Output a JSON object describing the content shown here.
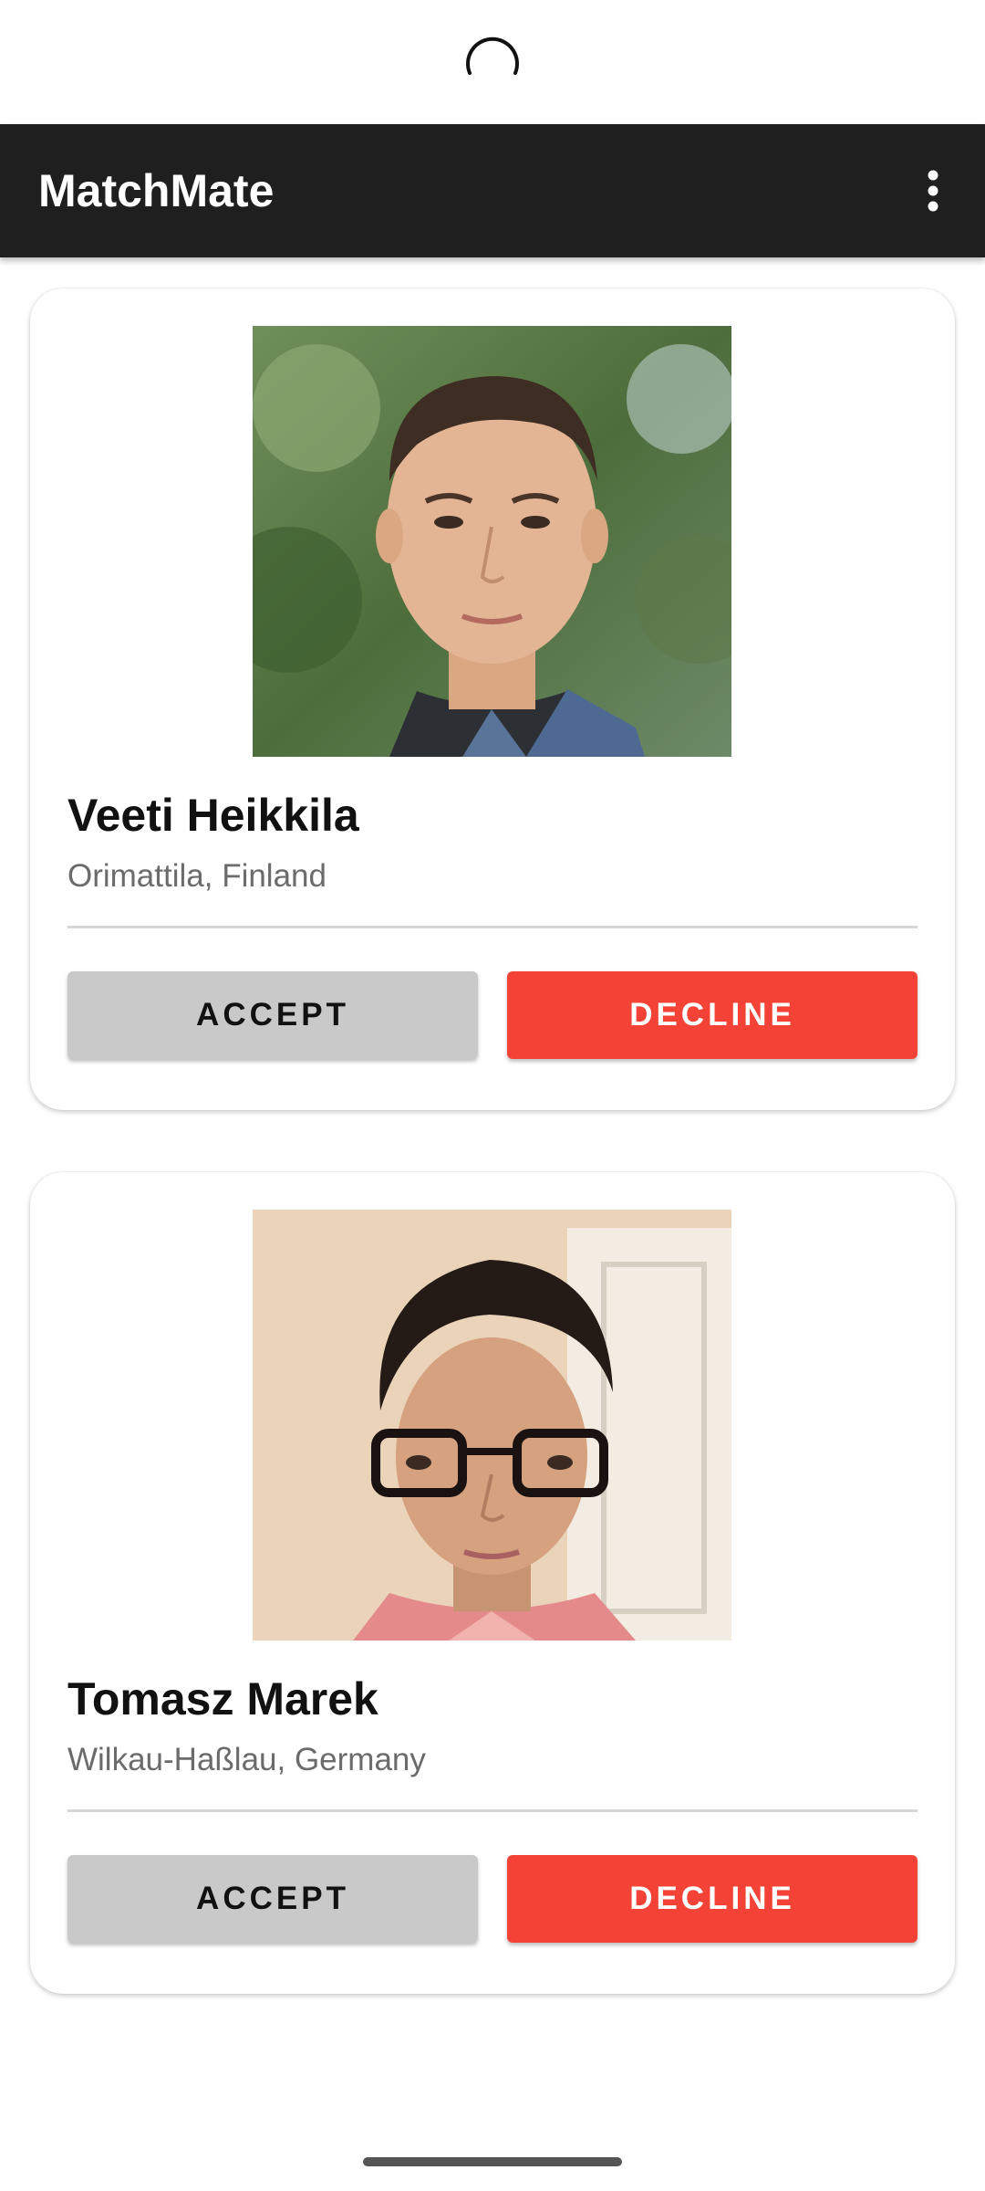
{
  "app": {
    "title": "MatchMate",
    "overflow_icon": "more-vert-icon",
    "refresh_icon": "loading-spinner-icon"
  },
  "cards": [
    {
      "name": "Veeti Heikkila",
      "location": "Orimattila, Finland",
      "accept_label": "ACCEPT",
      "decline_label": "DECLINE"
    },
    {
      "name": "Tomasz Marek",
      "location": "Wilkau-Haßlau, Germany",
      "accept_label": "ACCEPT",
      "decline_label": "DECLINE"
    }
  ],
  "colors": {
    "appbar": "#1f1f1f",
    "accept": "#c9c9c9",
    "decline": "#f44336"
  }
}
